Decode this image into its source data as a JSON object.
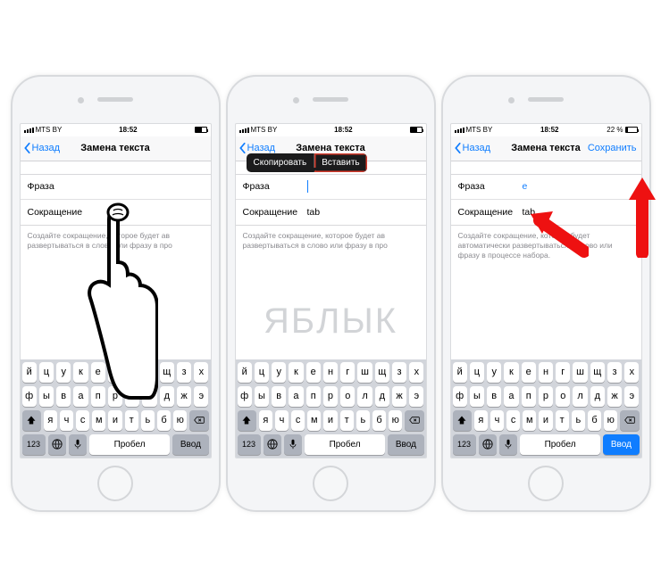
{
  "status": {
    "carrier": "MTS BY",
    "time": "18:52",
    "battery_pct": "22 %"
  },
  "nav": {
    "back": "Назад",
    "title": "Замена текста",
    "save": "Сохранить"
  },
  "form": {
    "phrase_label": "Фраза",
    "phrase_value_p3": "e",
    "shortcut_label": "Сокращение",
    "shortcut_value": "tab"
  },
  "hint": {
    "short": "Создайте сокращение, которое будет ав\nразвертываться в слово или фразу в про",
    "full": "Создайте сокращение, которое будет автоматически развертываться в слово или фразу в процессе набора."
  },
  "context_menu": {
    "copy": "Скопировать",
    "paste": "Вставить"
  },
  "keyboard": {
    "row1": [
      "й",
      "ц",
      "у",
      "к",
      "е",
      "н",
      "г",
      "ш",
      "щ",
      "з",
      "х"
    ],
    "row2": [
      "ф",
      "ы",
      "в",
      "а",
      "п",
      "р",
      "о",
      "л",
      "д",
      "ж",
      "э"
    ],
    "row3": [
      "я",
      "ч",
      "с",
      "м",
      "и",
      "т",
      "ь",
      "б",
      "ю"
    ],
    "k123": "123",
    "space": "Пробел",
    "enter": "Ввод"
  },
  "watermark": "ЯБЛЫК"
}
